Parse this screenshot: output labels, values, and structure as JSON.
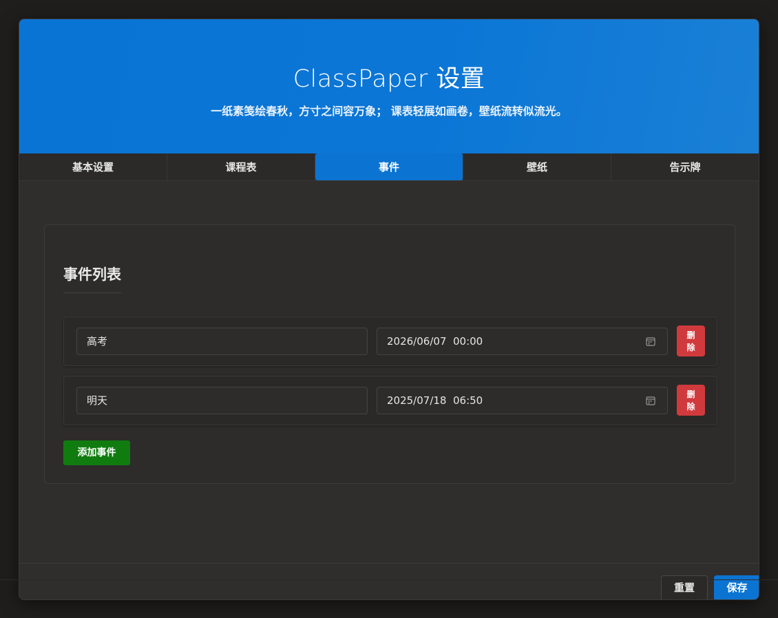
{
  "header": {
    "title": "ClassPaper 设置",
    "subtitle": "一纸素笺绘春秋，方寸之间容万象； 课表轻展如画卷，壁纸流转似流光。"
  },
  "tabs": [
    {
      "label": "基本设置",
      "active": false
    },
    {
      "label": "课程表",
      "active": false
    },
    {
      "label": "事件",
      "active": true
    },
    {
      "label": "壁纸",
      "active": false
    },
    {
      "label": "告示牌",
      "active": false
    }
  ],
  "events_panel": {
    "title": "事件列表",
    "events": [
      {
        "name": "高考",
        "datetime": "2026/06/07  00:00",
        "delete_label": "删除"
      },
      {
        "name": "明天",
        "datetime": "2025/07/18  06:50",
        "delete_label": "删除"
      }
    ],
    "add_label": "添加事件"
  },
  "footer": {
    "reset_label": "重置",
    "save_label": "保存"
  },
  "colors": {
    "accent": "#0b74d2",
    "danger": "#d13a3d",
    "success": "#107c10",
    "background": "#302e2d"
  },
  "icons": {
    "date_picker": "calendar-icon"
  }
}
